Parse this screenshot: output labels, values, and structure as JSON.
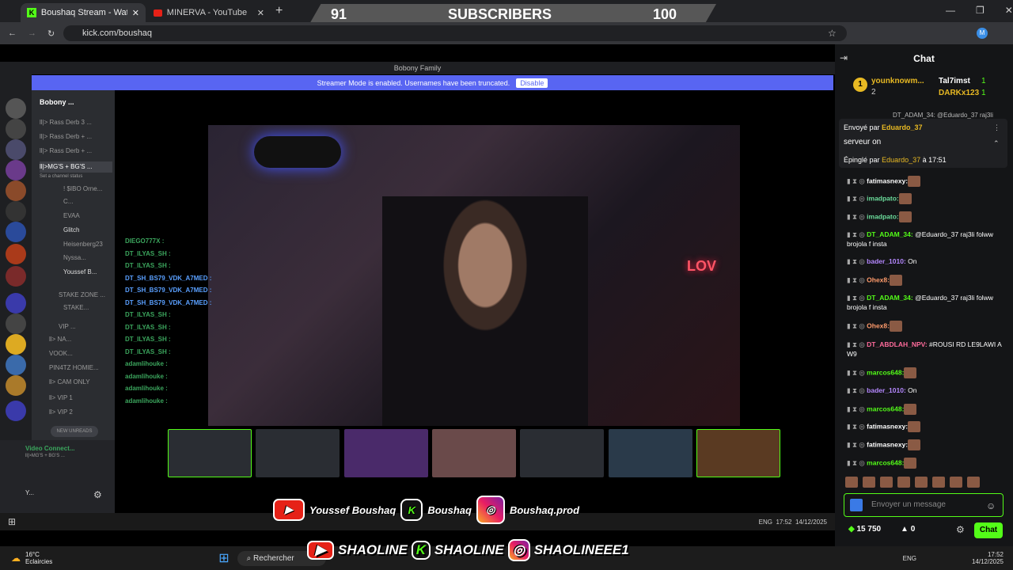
{
  "browser": {
    "tabs": [
      {
        "label": "Boushaq Stream - Watch Li..."
      },
      {
        "label": "MINERVA - YouTube"
      }
    ],
    "url": "kick.com/boushaq"
  },
  "subscribers": {
    "current": "91",
    "label": "SUBSCRIBERS",
    "goal": "100"
  },
  "discord": {
    "window_title": "Bobony Family",
    "streamer_mode_text": "Streamer Mode is enabled. Usernames have been truncated.",
    "disable_label": "Disable",
    "server_name": "Bobony ...",
    "channels": [
      "ll|> Rass Derb 3 ...",
      "ll|> Rass Derb + ...",
      "ll|> Rass Derb + ...",
      "ll|>MG'S + BG'S ...",
      "Set a channel status",
      "! $IBO Orne...",
      "C...",
      "EVAA",
      "Glitch",
      "Heisenberg23",
      "Nyssa...",
      "Youssef B...",
      "STAKE ZONE ...",
      "STAKE...",
      "VIP ...",
      "ll> NA...",
      "VOOK...",
      "PIN4TZ HOMIE...",
      "ll> CAM ONLY",
      "ll> VIP 1",
      "ll> VIP 2"
    ],
    "new_unreads": "NEW UNREADS",
    "voice_connected": "Video Connect...",
    "voice_sub": "ll|>MG'S + BG'S ...",
    "user": "Y...",
    "video_chat": [
      {
        "user": "DIEGO777X :",
        "blue": false
      },
      {
        "user": "DT_ILYAS_SH :",
        "blue": false
      },
      {
        "user": "DT_ILYAS_SH :",
        "blue": false
      },
      {
        "user": "DT_SH_BS79_VDK_A7MED :",
        "blue": true
      },
      {
        "user": "DT_SH_BS79_VDK_A7MED :",
        "blue": true
      },
      {
        "user": "DT_SH_BS79_VDK_A7MED :",
        "blue": true
      },
      {
        "user": "DT_ILYAS_SH :",
        "blue": false
      },
      {
        "user": "DT_ILYAS_SH :",
        "blue": false
      },
      {
        "user": "DT_ILYAS_SH :",
        "blue": false
      },
      {
        "user": "DT_ILYAS_SH :",
        "blue": false
      },
      {
        "user": "adamlihouke :",
        "blue": false
      },
      {
        "user": "adamlihouke :",
        "blue": false
      },
      {
        "user": "adamlihouke :",
        "blue": false
      },
      {
        "user": "adamlihouke :",
        "blue": false
      }
    ],
    "video_sign": "LOV",
    "clock": {
      "time": "17:52",
      "date": "14/12/2025",
      "lang": "ENG"
    }
  },
  "socials_top": {
    "youtube": "Youssef Boushaq",
    "kick": "Boushaq",
    "instagram": "Boushaq.prod"
  },
  "socials_bottom": {
    "youtube": "SHAOLINE",
    "kick": "SHAOLINE",
    "instagram": "SHAOLINEEE1"
  },
  "chat": {
    "title": "Chat",
    "top_gifter": {
      "rank": "1",
      "name": "younknowm...",
      "count": "2"
    },
    "gifters": [
      {
        "name": "Tal7imst",
        "count": "1"
      },
      {
        "name": "DARKx123",
        "count": "1"
      }
    ],
    "hidden_line": "DT_ADAM_34: @Eduardo_37 raj3li",
    "pinned": {
      "sent_by": "Envoyé par",
      "sender": "Eduardo_37",
      "text": "serveur on",
      "pinned_by": "Épinglé par",
      "pinner": "Eduardo_37",
      "time": "à 17:51"
    },
    "messages": [
      {
        "user": "fatimasnexy:",
        "text": "",
        "color": "#ffffff"
      },
      {
        "user": "imadpato:",
        "text": "",
        "color": "#6bdc9b"
      },
      {
        "user": "imadpato:",
        "text": "",
        "color": "#6bdc9b"
      },
      {
        "user": "DT_ADAM_34:",
        "text": " @Eduardo_37 raj3li folww brojola f insta",
        "color": "#53fc18"
      },
      {
        "user": "bader_1010:",
        "text": " On",
        "color": "#b588ff"
      },
      {
        "user": "Ohex8:",
        "text": "",
        "color": "#ff9b6b"
      },
      {
        "user": "DT_ADAM_34:",
        "text": " @Eduardo_37 raj3li folww brojola f insta",
        "color": "#53fc18"
      },
      {
        "user": "Ohex8:",
        "text": "",
        "color": "#ff9b6b"
      },
      {
        "user": "DT_ABDLAH_NPV:",
        "text": " #ROUSI RD LE9LAWI A W9",
        "color": "#ff6b9b"
      },
      {
        "user": "marcos648:",
        "text": "",
        "color": "#53fc18"
      },
      {
        "user": "bader_1010:",
        "text": " On",
        "color": "#b588ff"
      },
      {
        "user": "marcos648:",
        "text": "",
        "color": "#53fc18"
      },
      {
        "user": "fatimasnexy:",
        "text": "",
        "color": "#ffffff"
      },
      {
        "user": "fatimasnexy:",
        "text": "",
        "color": "#ffffff"
      },
      {
        "user": "marcos648:",
        "text": "",
        "color": "#53fc18"
      }
    ],
    "input_placeholder": "Envoyer un message",
    "points": "15 750",
    "viewers": "0",
    "send_label": "Chat"
  },
  "windows": {
    "weather_temp": "16°C",
    "weather_desc": "Eclaircies",
    "search": "Rechercher",
    "lang": "ENG",
    "time": "17:52",
    "date": "14/12/2025"
  }
}
